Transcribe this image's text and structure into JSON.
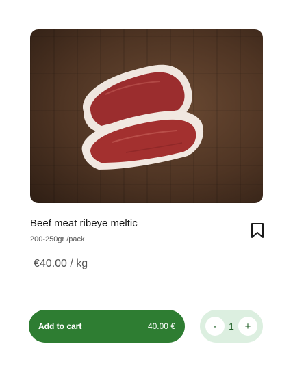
{
  "product": {
    "name": "Beef meat ribeye meltic",
    "pack": "200-250gr /pack",
    "price": "€40.00 / kg"
  },
  "cart": {
    "add_label": "Add to cart",
    "total": "40.00 €"
  },
  "quantity": {
    "decrement_label": "-",
    "value": "1",
    "increment_label": "+"
  },
  "icons": {
    "bookmark": "bookmark-icon"
  },
  "colors": {
    "accent": "#2e7d32",
    "stepper_bg": "#dcefe0"
  }
}
